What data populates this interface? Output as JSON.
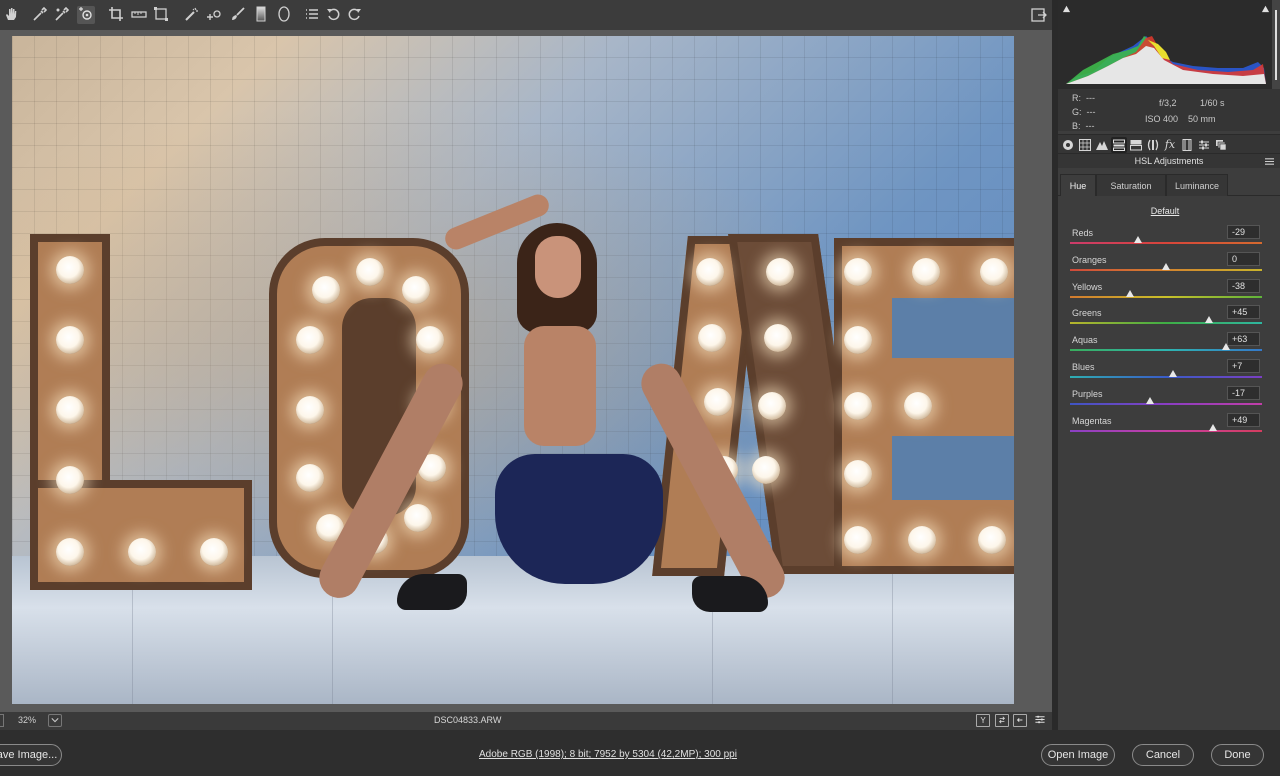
{
  "toolbar": {
    "tools": [
      "hand-tool",
      "white-balance-tool",
      "color-sampler-tool",
      "targeted-adjustment-tool",
      "crop-tool",
      "straighten-tool",
      "transform-tool",
      "spot-removal-tool",
      "red-eye-tool",
      "adjustment-brush",
      "graduated-filter",
      "radial-filter",
      "preferences",
      "rotate-counterclockwise",
      "rotate-clockwise"
    ]
  },
  "canvas": {
    "zoom": "32%",
    "filename": "DSC04833.ARW"
  },
  "info": {
    "r_label": "R:",
    "r_value": "---",
    "g_label": "G:",
    "g_value": "---",
    "b_label": "B:",
    "b_value": "---",
    "aperture": "f/3,2",
    "shutter": "1/60 s",
    "iso": "ISO 400",
    "focal": "50 mm"
  },
  "panel": {
    "title": "HSL Adjustments",
    "tabs": [
      "Hue",
      "Saturation",
      "Luminance"
    ],
    "active_tab": "Hue",
    "default_label": "Default",
    "sliders": [
      {
        "label": "Reds",
        "value": "-29",
        "level": -29,
        "track": "linear-gradient(90deg,#cc3b6b,#d8453a,#d56a2f)"
      },
      {
        "label": "Oranges",
        "value": "0",
        "level": 0,
        "track": "linear-gradient(90deg,#d04a3a,#d3842e,#c9b32c)"
      },
      {
        "label": "Yellows",
        "value": "-38",
        "level": -38,
        "track": "linear-gradient(90deg,#d27a2e,#c9c02a,#5fb43a)"
      },
      {
        "label": "Greens",
        "value": "+45",
        "level": 45,
        "track": "linear-gradient(90deg,#b7b42c,#3fae45,#2eb6a0)"
      },
      {
        "label": "Aquas",
        "value": "+63",
        "level": 63,
        "track": "linear-gradient(90deg,#39ad5c,#2eb5b0,#3579c9)"
      },
      {
        "label": "Blues",
        "value": "+7",
        "level": 7,
        "track": "linear-gradient(90deg,#2eaeb2,#3a5cc8,#7a3fc4)"
      },
      {
        "label": "Purples",
        "value": "-17",
        "level": -17,
        "track": "linear-gradient(90deg,#3e55c4,#8a3ec4,#c13ea8)"
      },
      {
        "label": "Magentas",
        "value": "+49",
        "level": 49,
        "track": "linear-gradient(90deg,#8a40c4,#c63fa4,#d43d5f)"
      }
    ]
  },
  "bottombar": {
    "save_label": "ave Image...",
    "workflow": "Adobe RGB (1998); 8 bit; 7952 by 5304 (42,2MP); 300 ppi",
    "open_label": "Open Image",
    "cancel_label": "Cancel",
    "done_label": "Done"
  },
  "colors": {
    "panel_bg": "#3d3d3d",
    "canvas_bg": "#5a5a5a",
    "bar_bg": "#2e2e2e"
  }
}
